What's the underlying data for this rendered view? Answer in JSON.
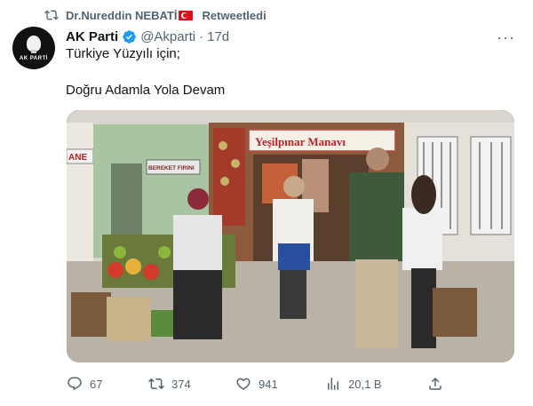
{
  "retweet": {
    "user": "Dr.Nureddin NEBATİ",
    "flag_icon": "turkey-flag",
    "label": "Retweetledi"
  },
  "tweet": {
    "avatar_text": "AK PARTİ",
    "display_name": "AK Parti",
    "handle": "@Akparti",
    "separator": "·",
    "time": "17d",
    "text_line1": "Türkiye Yüzyılı için;",
    "text_line2": "Doğru Adamla Yola Devam",
    "media": {
      "shop_sign": "Yeşilpınar Manavı",
      "left_sign": "BEREKET FIRINI",
      "edge_sign": "ANE"
    }
  },
  "actions": {
    "replies": "67",
    "retweets": "374",
    "likes": "941",
    "views": "20,1 B"
  },
  "colors": {
    "secondary": "#536471",
    "verified": "#1d9bf0",
    "text": "#0f1419"
  }
}
